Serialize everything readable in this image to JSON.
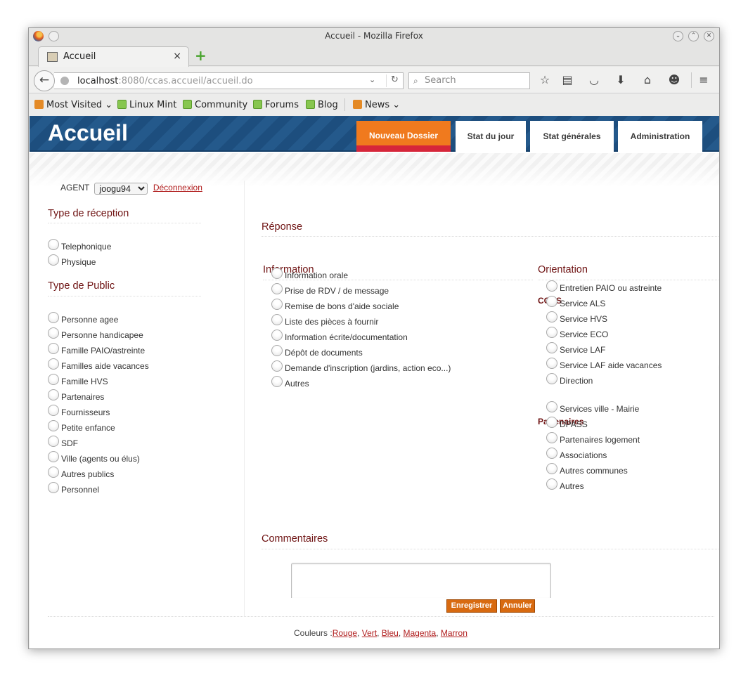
{
  "window": {
    "title": "Accueil - Mozilla Firefox"
  },
  "tab": {
    "label": "Accueil",
    "close": "×",
    "new_tab": "+"
  },
  "nav": {
    "back": "←",
    "url_host": "localhost",
    "url_rest": ":8080/ccas.accueil/accueil.do",
    "url_dropdown": "⌄",
    "reload": "↻",
    "search_placeholder": "Search",
    "search_glyph": "⌕",
    "toolbar_icons": [
      "star-icon",
      "reading-list-icon",
      "pocket-icon",
      "download-icon",
      "home-icon",
      "chat-icon",
      "menu-icon"
    ]
  },
  "bookmarks": [
    {
      "label": "Most Visited ⌄",
      "icon": "rss"
    },
    {
      "label": "Linux Mint",
      "icon": "mint"
    },
    {
      "label": "Community",
      "icon": "mint"
    },
    {
      "label": "Forums",
      "icon": "mint"
    },
    {
      "label": "Blog",
      "icon": "mint"
    },
    {
      "label": "News ⌄",
      "icon": "rss"
    }
  ],
  "site": {
    "title": "Accueil",
    "tabs": [
      "Nouveau Dossier",
      "Stat du jour",
      "Stat générales",
      "Administration"
    ],
    "colors": {
      "header_blue": "#1d4e7e",
      "active_tab_orange": "#f07a1e",
      "active_tab_red": "#d6263a",
      "heading_maroon": "#6e1212",
      "button_orange": "#d86a10"
    }
  },
  "agent": {
    "label": "AGENT",
    "selected": "joogu94",
    "logout": "Déconnexion"
  },
  "reception": {
    "title": "Type de réception",
    "options": [
      "Telephonique",
      "Physique"
    ]
  },
  "public": {
    "title": "Type de Public",
    "options": [
      "Personne agee",
      "Personne handicapee",
      "Famille PAIO/astreinte",
      "Familles aide vacances",
      "Famille HVS",
      "Partenaires",
      "Fournisseurs",
      "Petite enfance",
      "SDF",
      "Ville (agents ou élus)",
      "Autres publics",
      "Personnel"
    ]
  },
  "reponse": {
    "title": "Réponse"
  },
  "information": {
    "title": "Information",
    "options": [
      "Information orale",
      "Prise de RDV / de message",
      "Remise de bons d'aide sociale",
      "Liste des pièces à fournir",
      "Information écrite/documentation",
      "Dépôt de documents",
      "Demande d'inscription (jardins, action eco...)",
      "Autres"
    ]
  },
  "orientation": {
    "title": "Orientation",
    "ccas_label": "CCAS",
    "ccas_options": [
      "Entretien PAIO ou astreinte",
      "Service ALS",
      "Service HVS",
      "Service ECO",
      "Service LAF",
      "Service LAF aide vacances",
      "Direction"
    ],
    "partners_label": "Partenaires",
    "partner_options": [
      "Services ville - Mairie",
      "DPASS",
      "Partenaires logement",
      "Associations",
      "Autres communes",
      "Autres"
    ]
  },
  "comments": {
    "title": "Commentaires",
    "save": "Enregistrer",
    "cancel": "Annuler"
  },
  "footer": {
    "prefix": "Couleurs :",
    "links": [
      "Rouge",
      "Vert",
      "Bleu",
      "Magenta",
      "Marron"
    ]
  }
}
